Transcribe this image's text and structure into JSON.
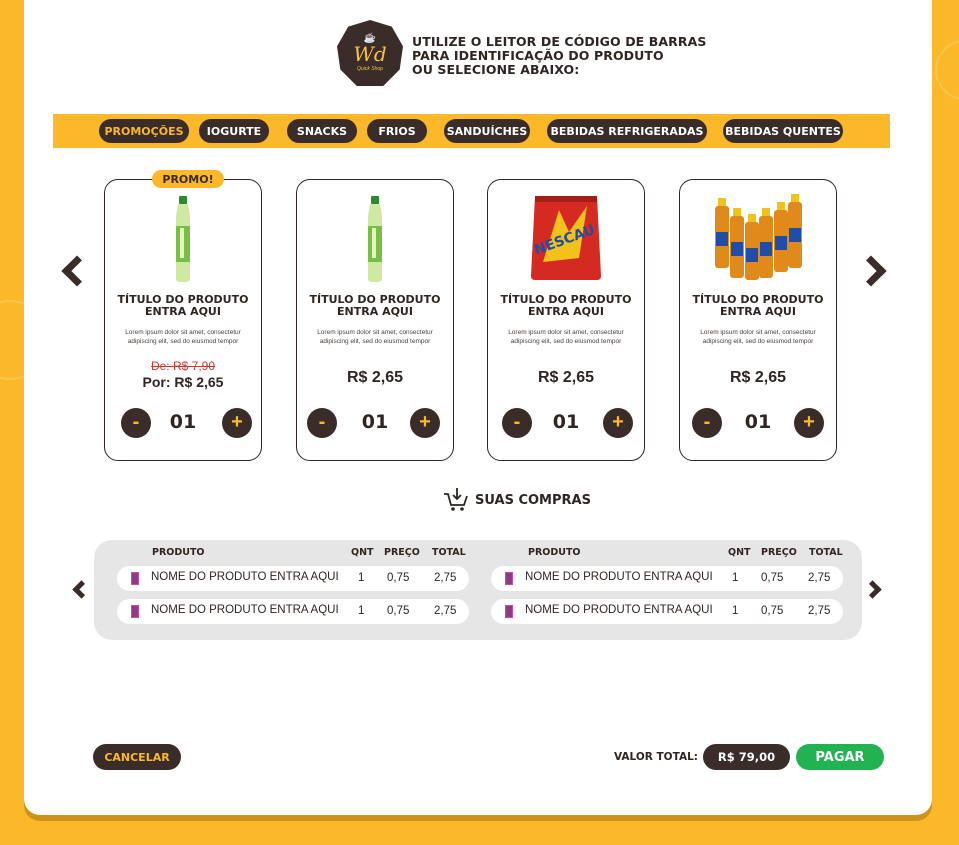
{
  "brand": {
    "logo_mark": "Wd",
    "logo_sub": "Quick Shop"
  },
  "header": {
    "line1": "UTILIZE O LEITOR DE CÓDIGO DE BARRAS",
    "line2": "PARA IDENTIFICAÇÃO DO PRODUTO",
    "line3": "OU SELECIONE ABAIXO:"
  },
  "categories": [
    {
      "label": "PROMOÇÕES",
      "active": true
    },
    {
      "label": "IOGURTE"
    },
    {
      "label": "SNACKS"
    },
    {
      "label": "FRIOS"
    },
    {
      "label": "SANDUÍCHES"
    },
    {
      "label": "BEBIDAS REFRIGERADAS"
    },
    {
      "label": "BEBIDAS QUENTES"
    }
  ],
  "promo_badge": "PROMO!",
  "products": [
    {
      "image": "water-bottle",
      "title_line1": "TÍTULO DO PRODUTO",
      "title_line2": "ENTRA AQUI",
      "desc": "Lorem ipsum dolor sit amet, consectetur adipiscing elit, sed do eiusmod tempor",
      "old_price": "De: R$ 7,90",
      "new_price": "Por: R$ 2,65",
      "qty": "01"
    },
    {
      "image": "water-bottle",
      "title_line1": "TÍTULO DO PRODUTO",
      "title_line2": "ENTRA AQUI",
      "desc": "Lorem ipsum dolor sit amet, consectetur adipiscing elit, sed do eiusmod tempor",
      "price": "R$ 2,65",
      "qty": "01"
    },
    {
      "image": "nescau-pack",
      "title_line1": "TÍTULO DO PRODUTO",
      "title_line2": "ENTRA AQUI",
      "desc": "Lorem ipsum dolor sit amet, consectetur adipiscing elit, sed do eiusmod tempor",
      "price": "R$ 2,65",
      "qty": "01"
    },
    {
      "image": "veja-bottles",
      "title_line1": "TÍTULO DO PRODUTO",
      "title_line2": "ENTRA AQUI",
      "desc": "Lorem ipsum dolor sit amet, consectetur adipiscing elit, sed do eiusmod tempor",
      "price": "R$ 2,65",
      "qty": "01"
    }
  ],
  "qty_minus": "-",
  "qty_plus": "+",
  "cart": {
    "title": "SUAS COMPRAS",
    "col_product": "PRODUTO",
    "col_qty": "QNT",
    "col_price": "PREÇO",
    "col_total": "TOTAL",
    "rows": [
      {
        "name": "NOME DO PRODUTO ENTRA AQUI",
        "qty": "1",
        "price": "0,75",
        "total": "2,75"
      },
      {
        "name": "NOME DO PRODUTO ENTRA AQUI",
        "qty": "1",
        "price": "0,75",
        "total": "2,75"
      },
      {
        "name": "NOME DO PRODUTO ENTRA AQUI",
        "qty": "1",
        "price": "0,75",
        "total": "2,75"
      },
      {
        "name": "NOME DO PRODUTO ENTRA AQUI",
        "qty": "1",
        "price": "0,75",
        "total": "2,75"
      }
    ]
  },
  "footer": {
    "cancel": "CANCELAR",
    "total_label": "VALOR TOTAL:",
    "total_value": "R$ 79,00",
    "pay": "PAGAR"
  },
  "colors": {
    "accent": "#fbb829",
    "dark": "#3a2c29",
    "pay": "#21b352",
    "old_price": "#d6342b"
  }
}
